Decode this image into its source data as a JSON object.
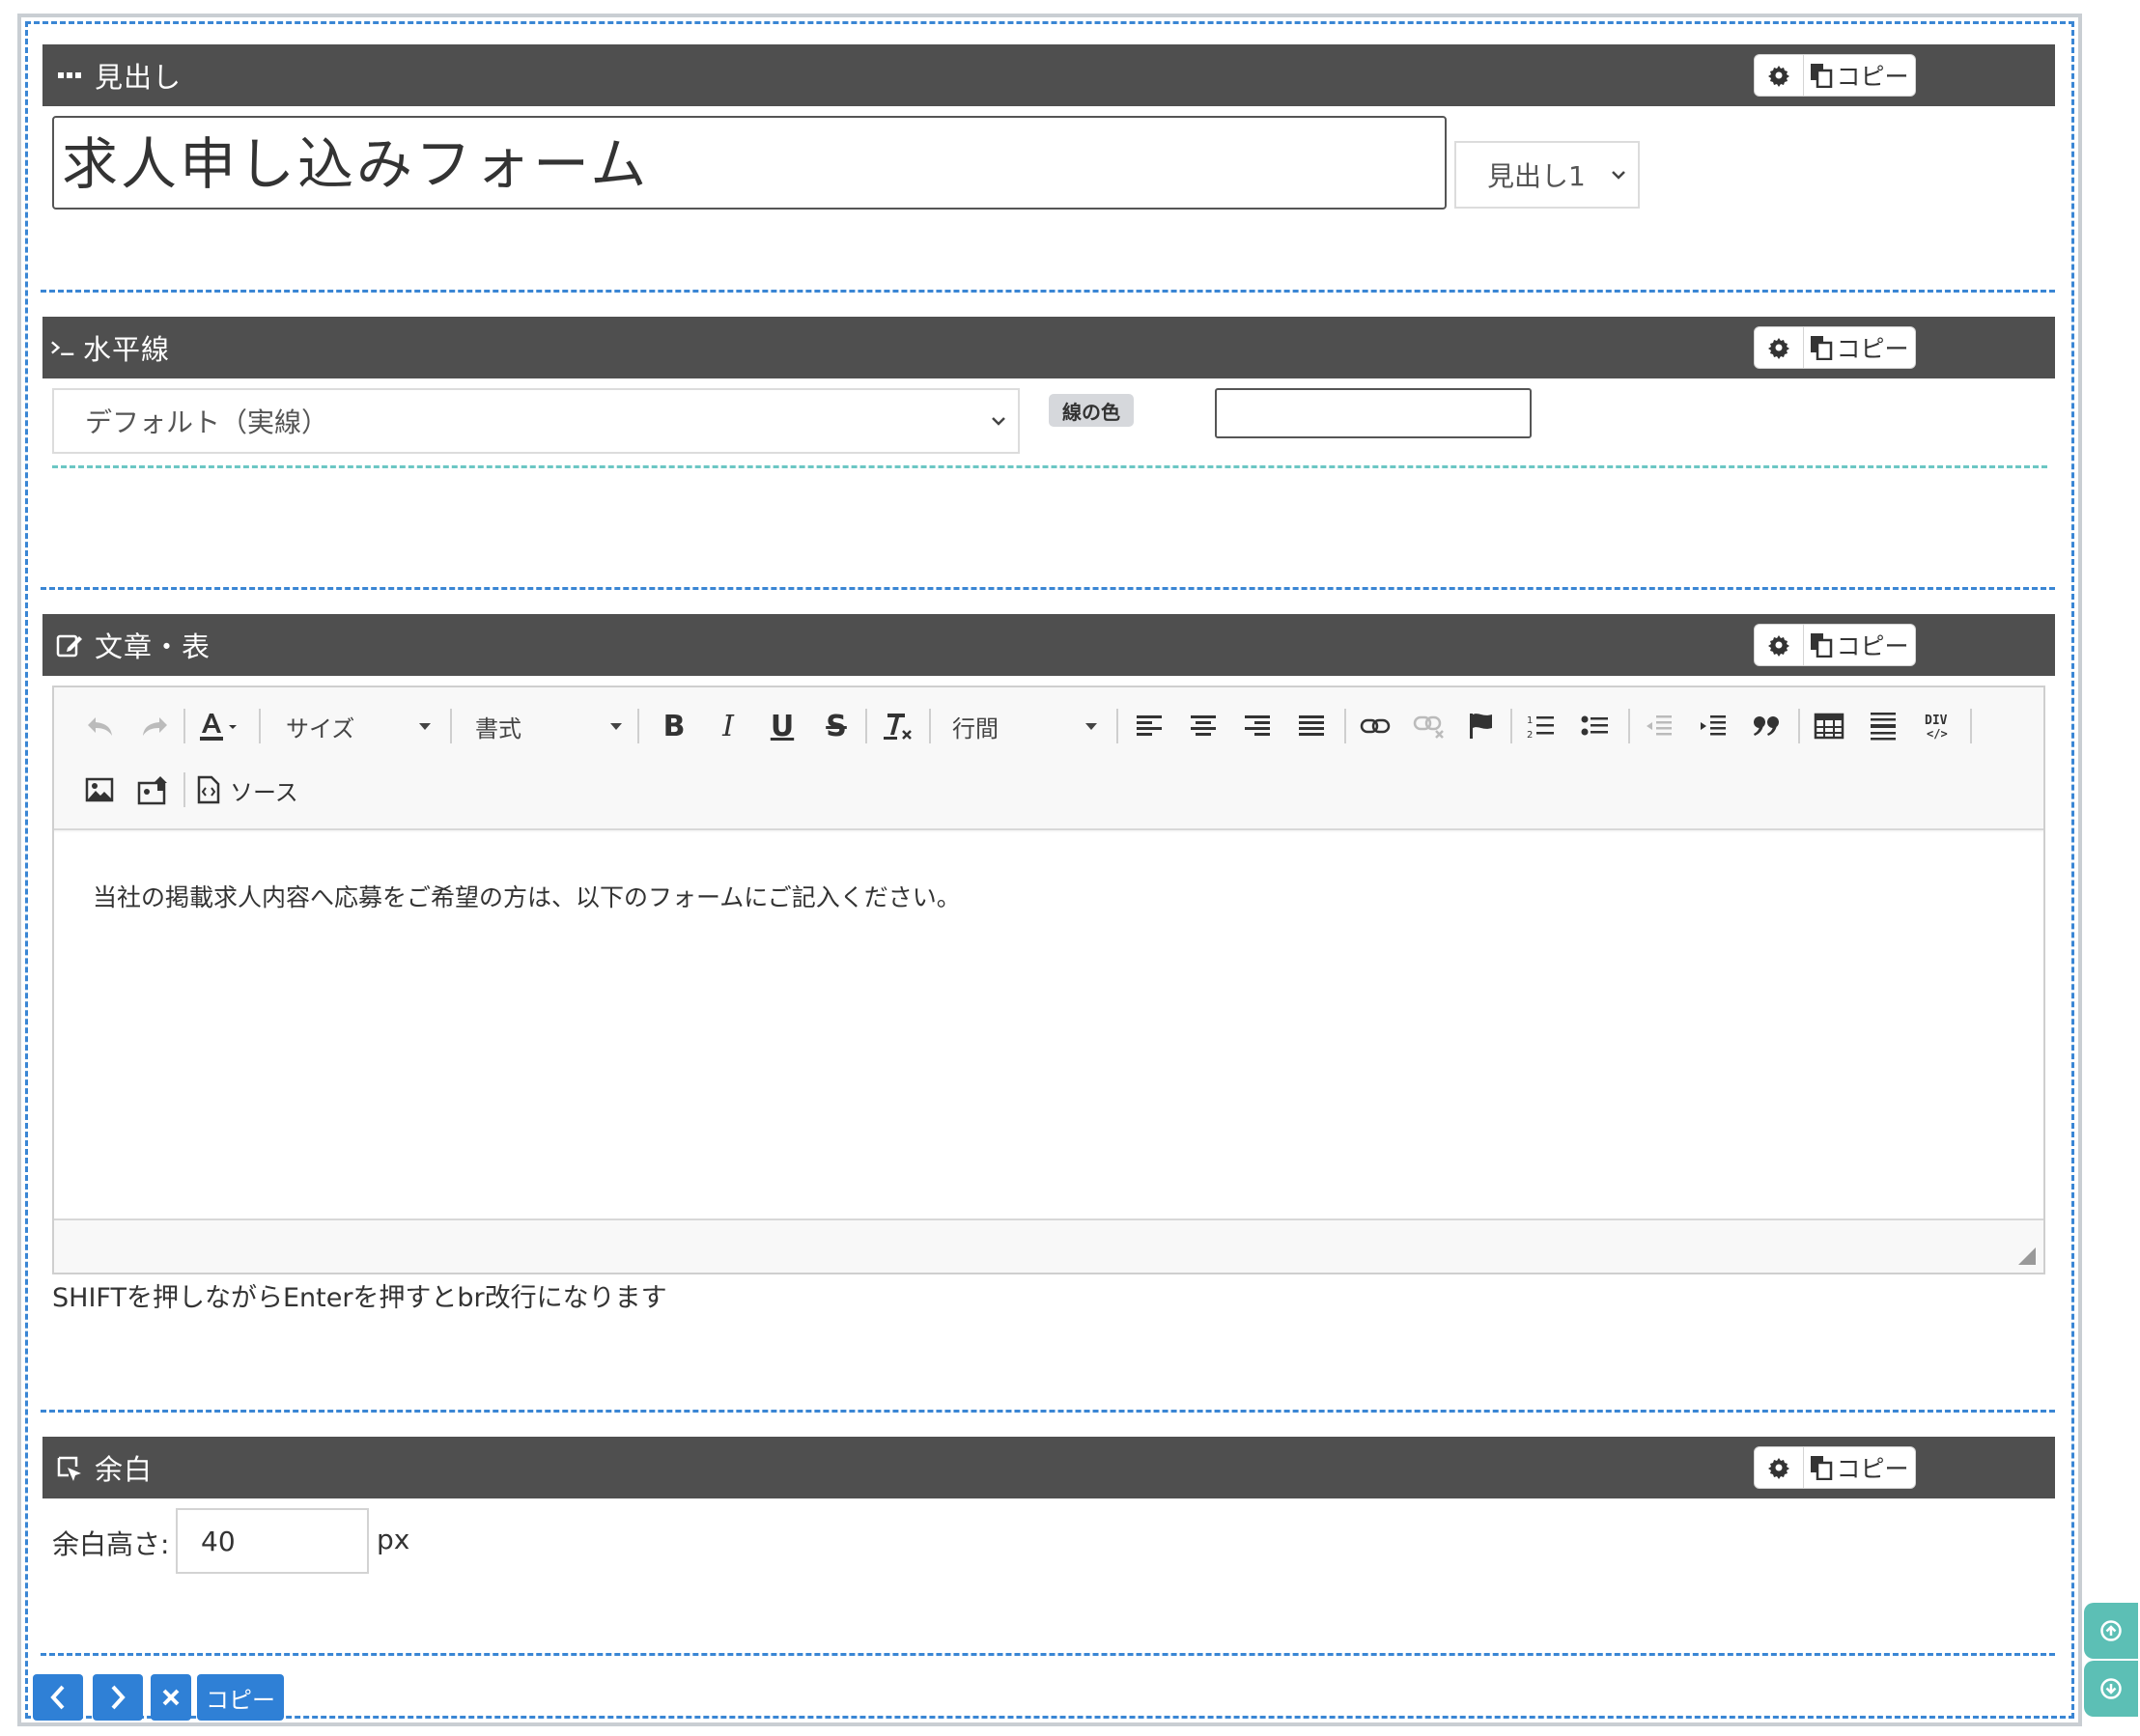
{
  "blocks": {
    "heading": {
      "title": "見出し",
      "value": "求人申し込みフォーム",
      "level": "見出し1"
    },
    "hr": {
      "title": "水平線",
      "style": "デフォルト（実線）",
      "color_label": "線の色",
      "color_value": ""
    },
    "text": {
      "title": "文章・表",
      "toolbar": {
        "size": "サイズ",
        "format": "書式",
        "line_height": "行間",
        "source": "ソース"
      },
      "body": "当社の掲載求人内容へ応募をご希望の方は、以下のフォームにご記入ください。",
      "hint": "SHIFTを押しながらEnterを押すとbr改行になります"
    },
    "spacer": {
      "title": "余白",
      "label": "余白高さ:",
      "value": "40",
      "unit": "px"
    }
  },
  "block_tools": {
    "copy_label": "コピー"
  },
  "bottom_nav": {
    "copy_label": "コピー"
  },
  "colors": {
    "header_bg": "#4f4f4f",
    "accent": "#2f80d6",
    "side_button": "#5cbfb5"
  }
}
